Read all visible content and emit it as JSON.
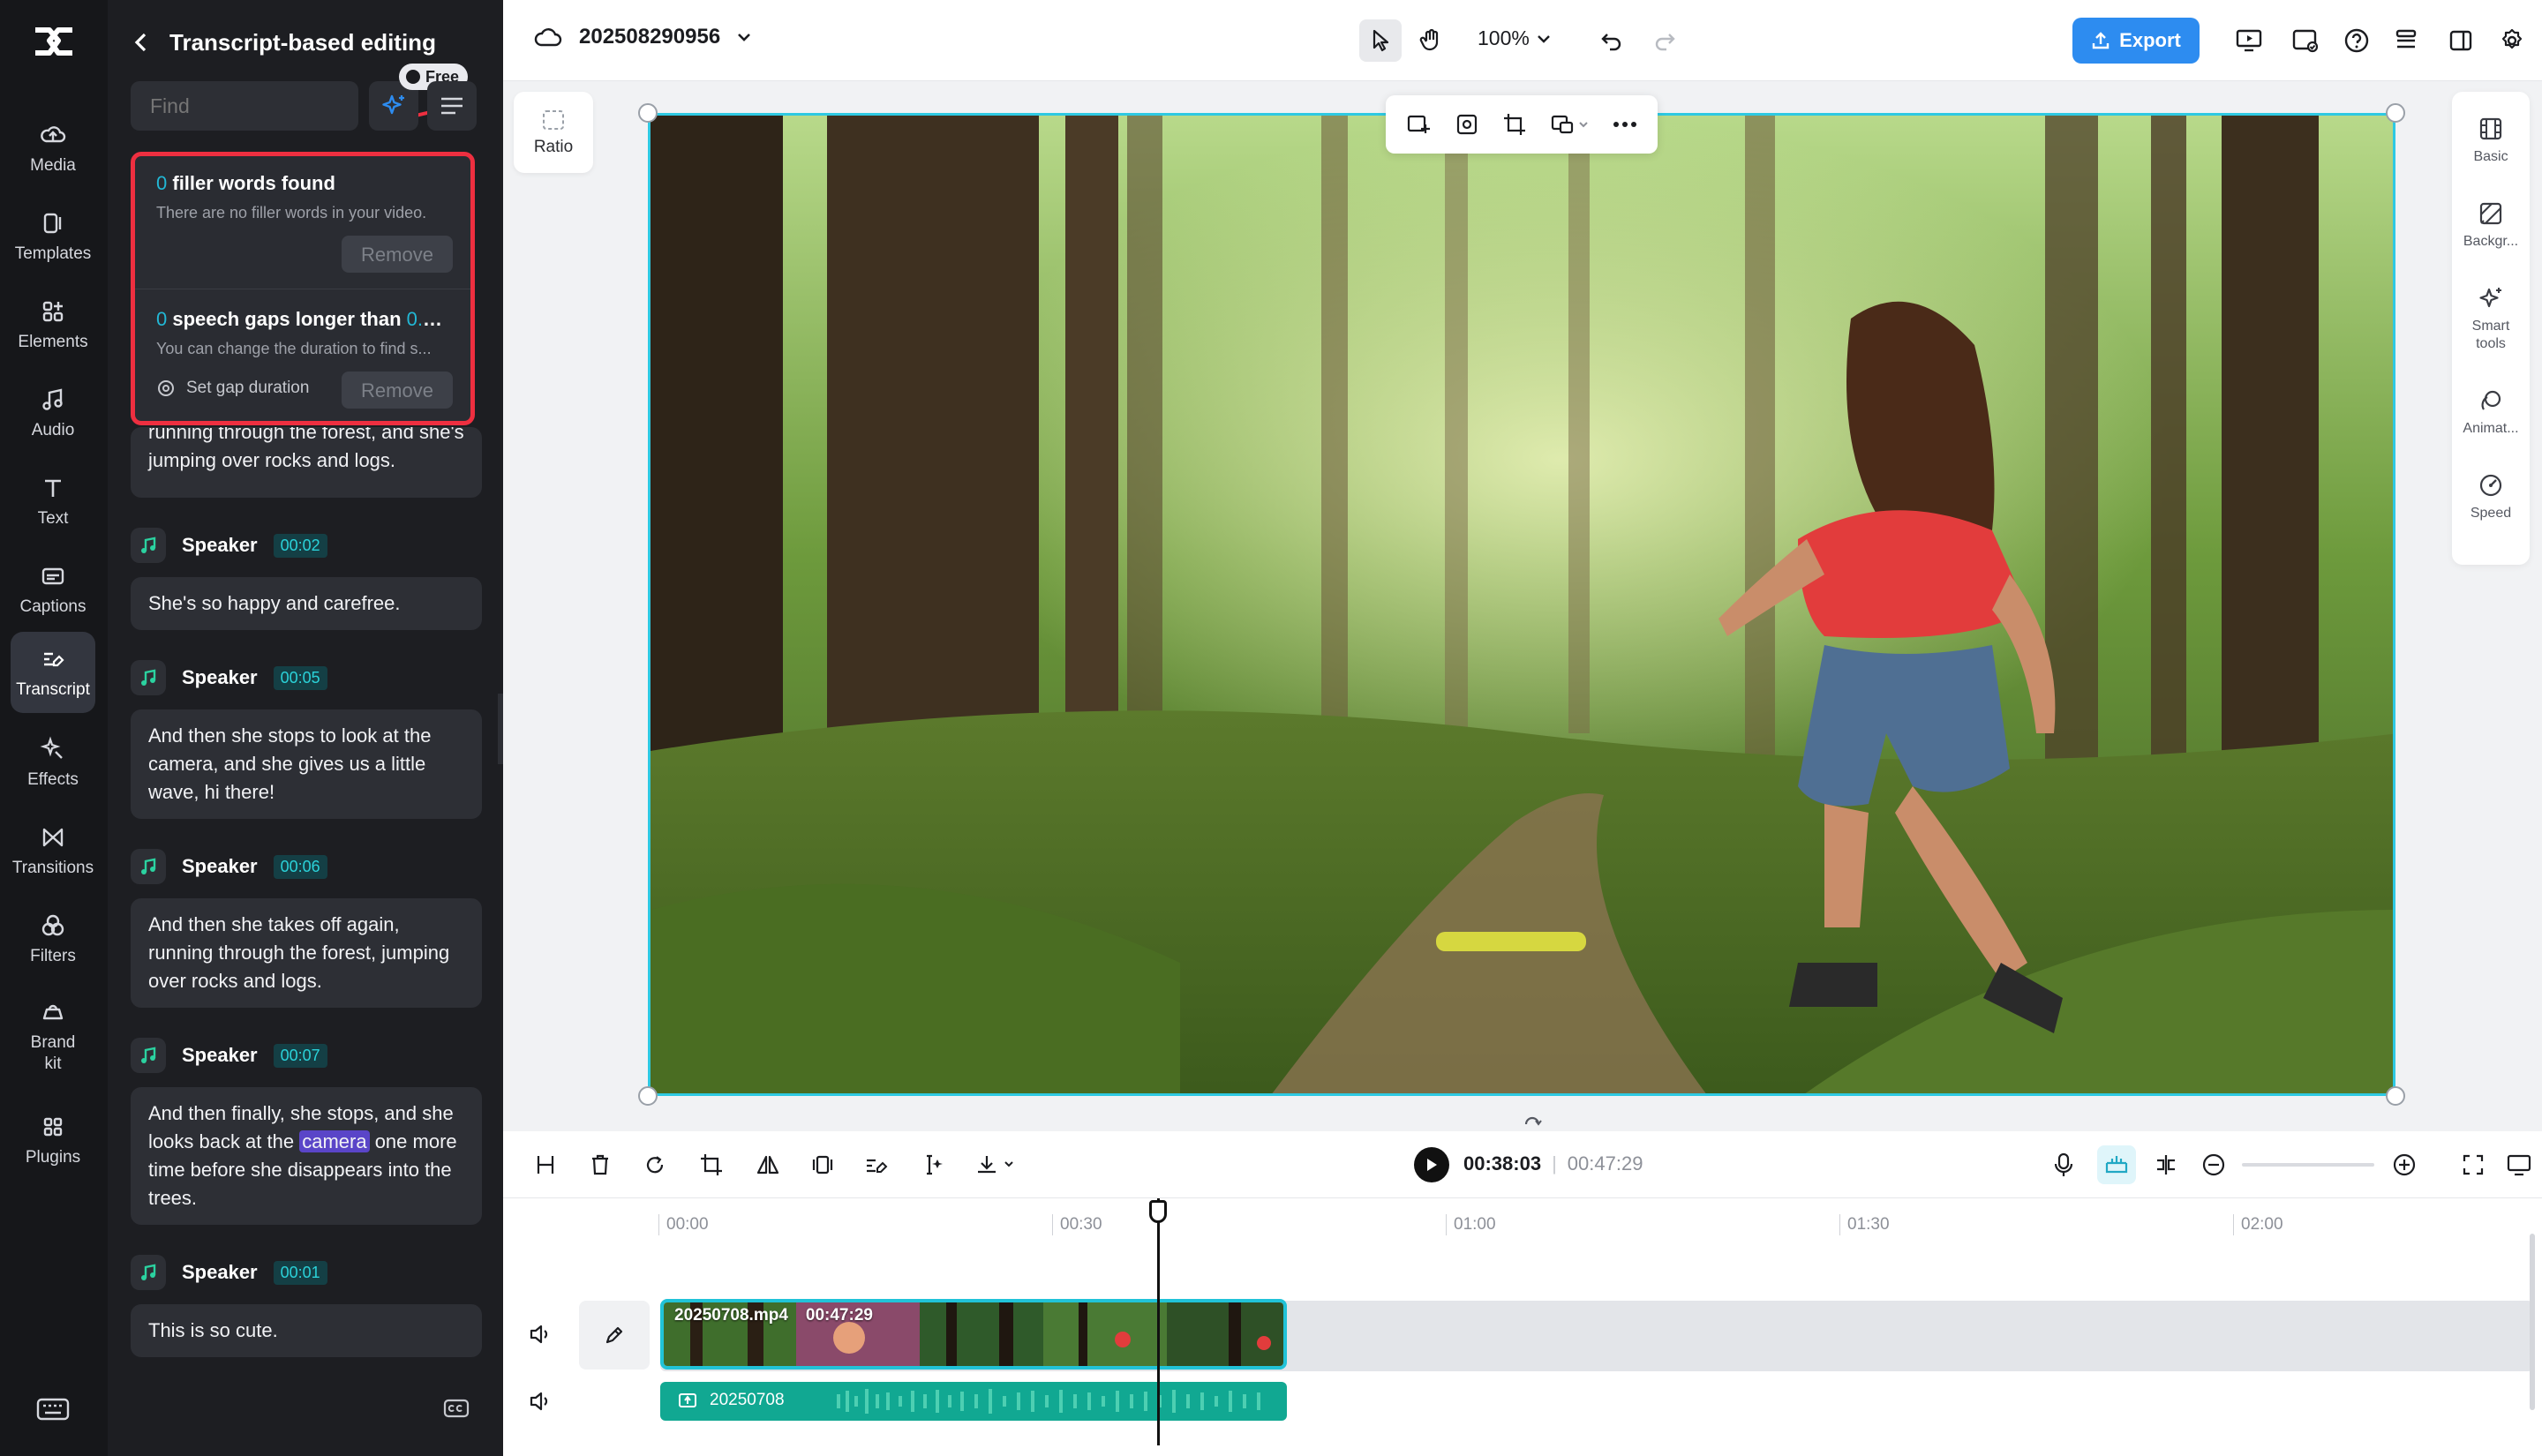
{
  "rail": {
    "items": [
      {
        "label": "Media",
        "icon": "media-icon"
      },
      {
        "label": "Templates",
        "icon": "templates-icon"
      },
      {
        "label": "Elements",
        "icon": "elements-icon"
      },
      {
        "label": "Audio",
        "icon": "audio-icon"
      },
      {
        "label": "Text",
        "icon": "text-icon"
      },
      {
        "label": "Captions",
        "icon": "captions-icon"
      },
      {
        "label": "Transcript",
        "icon": "transcript-icon"
      },
      {
        "label": "Effects",
        "icon": "effects-icon"
      },
      {
        "label": "Transitions",
        "icon": "transitions-icon"
      },
      {
        "label": "Filters",
        "icon": "filters-icon"
      },
      {
        "label": "Brand kit",
        "icon": "brand-kit-icon"
      },
      {
        "label": "Plugins",
        "icon": "plugins-icon"
      }
    ],
    "active": "Transcript"
  },
  "panel": {
    "title": "Transcript-based editing",
    "find_placeholder": "Find",
    "free_badge": "Free",
    "filler": {
      "count": "0",
      "title_rest": " filler words found",
      "subtitle": "There are no filler words in your video.",
      "remove": "Remove"
    },
    "gaps": {
      "count": "0",
      "title_mid": " speech gaps longer than ",
      "duration": "0.5s...",
      "subtitle": "You can change the duration to find s...",
      "set_gap": "Set gap duration",
      "remove": "Remove"
    },
    "first_card_text": "running through the forest, and she's jumping over rocks and logs.",
    "entries": [
      {
        "speaker": "Speaker",
        "time": "00:02",
        "text": "She's so happy and carefree."
      },
      {
        "speaker": "Speaker",
        "time": "00:05",
        "text": "And then she stops to look at the camera, and she gives us a little wave, hi there!"
      },
      {
        "speaker": "Speaker",
        "time": "00:06",
        "text": "And then she takes off again, running through the forest, jumping over rocks and logs."
      },
      {
        "speaker": "Speaker",
        "time": "00:07",
        "text_before": "And then finally, she stops, and she looks back at the ",
        "highlight": "camera",
        "text_after": " one more time before she disappears into the trees."
      },
      {
        "speaker": "Speaker",
        "time": "00:01",
        "text": "This is so cute."
      }
    ]
  },
  "topbar": {
    "project_name": "202508290956",
    "zoom": "100%",
    "export_label": "Export"
  },
  "canvas": {
    "ratio_label": "Ratio",
    "right_props": [
      {
        "label": "Basic",
        "icon": "basic-icon"
      },
      {
        "label": "Backgr...",
        "icon": "background-icon"
      },
      {
        "label": "Smart tools",
        "icon": "smart-tools-icon"
      },
      {
        "label": "Animat...",
        "icon": "animation-icon"
      },
      {
        "label": "Speed",
        "icon": "speed-icon"
      }
    ]
  },
  "controls": {
    "current_time": "00:38:03",
    "separator": "|",
    "duration": "00:47:29"
  },
  "timeline": {
    "ticks": [
      "00:00",
      "00:30",
      "01:00",
      "01:30",
      "02:00"
    ],
    "video_clip_name": "20250708.mp4",
    "video_clip_duration": "00:47:29",
    "audio_clip_name": "20250708"
  },
  "colors": {
    "accent": "#2d8cf0",
    "highlight_red": "#ee2f40",
    "teal": "#21c3d8",
    "audio_green": "#11a892"
  }
}
